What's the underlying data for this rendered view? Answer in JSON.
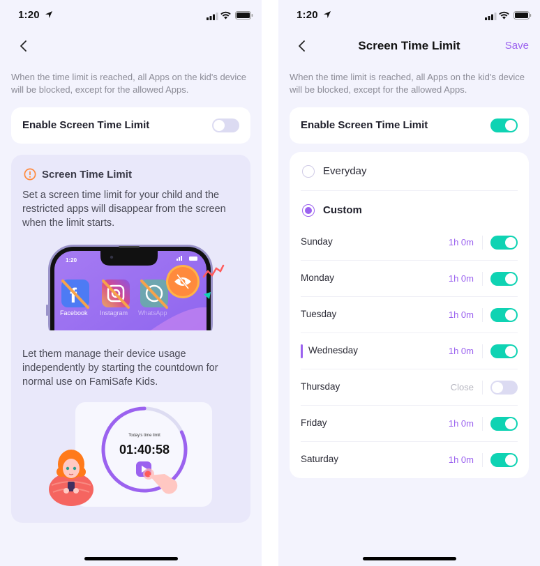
{
  "status_bar": {
    "time": "1:20"
  },
  "left_screen": {
    "description": "When the time limit is reached, all Apps on the kid's device will be blocked, except for the allowed Apps.",
    "enable": {
      "label": "Enable Screen Time Limit",
      "on": false
    },
    "info_card": {
      "title": "Screen Time Limit",
      "text_1": "Set a screen time limit for your child and the restricted apps will disappear from the screen when the limit starts.",
      "text_2": "Let them manage their device usage independently by starting the countdown for normal use on FamiSafe Kids.",
      "phone_illustration": {
        "time": "1:20",
        "apps": [
          "Facebook",
          "Instagram",
          "WhatsApp"
        ]
      },
      "timer_illustration": {
        "caption": "Today's time limit",
        "countdown": "01:40:58",
        "progress_fraction": 0.82
      }
    }
  },
  "right_screen": {
    "title": "Screen Time Limit",
    "save_label": "Save",
    "description": "When the time limit is reached, all Apps on the kid's device will be blocked, except for the allowed Apps.",
    "enable": {
      "label": "Enable Screen Time Limit",
      "on": true
    },
    "options": [
      {
        "label": "Everyday",
        "selected": false
      },
      {
        "label": "Custom",
        "selected": true
      }
    ],
    "days": [
      {
        "name": "Sunday",
        "value": "1h 0m",
        "on": true,
        "active": false
      },
      {
        "name": "Monday",
        "value": "1h 0m",
        "on": true,
        "active": false
      },
      {
        "name": "Tuesday",
        "value": "1h 0m",
        "on": true,
        "active": false
      },
      {
        "name": "Wednesday",
        "value": "1h 0m",
        "on": true,
        "active": true
      },
      {
        "name": "Thursday",
        "value": "Close",
        "on": false,
        "active": false
      },
      {
        "name": "Friday",
        "value": "1h 0m",
        "on": true,
        "active": false
      },
      {
        "name": "Saturday",
        "value": "1h 0m",
        "on": true,
        "active": false
      }
    ]
  },
  "colors": {
    "accent_purple": "#9b62ef",
    "toggle_on": "#0fd3b3",
    "toggle_off": "#dcdbf2",
    "warning_orange": "#ff8a3d",
    "background": "#f3f3fd"
  }
}
